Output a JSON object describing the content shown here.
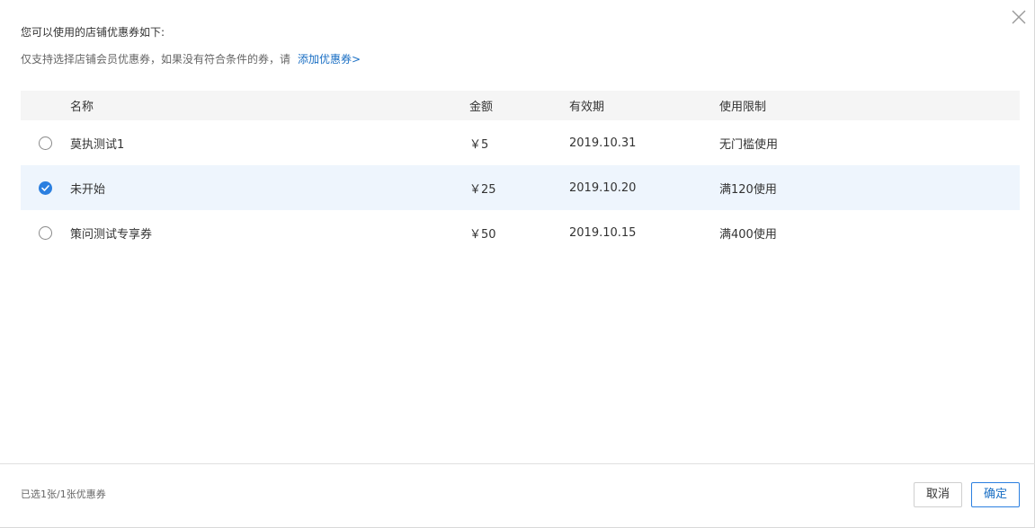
{
  "dialog": {
    "intro_title": "您可以使用的店铺优惠券如下:",
    "intro_hint": "仅支持选择店铺会员优惠券，如果没有符合条件的券，请",
    "add_link": "添加优惠券>",
    "close_icon": "close-icon"
  },
  "table": {
    "headers": {
      "name": "名称",
      "amount": "金额",
      "validity": "有效期",
      "limit": "使用限制"
    },
    "rows": [
      {
        "name": "莫执测试1",
        "amount": "￥5",
        "validity": "2019.10.31",
        "limit": "无门槛使用",
        "selected": false
      },
      {
        "name": "未开始",
        "amount": "￥25",
        "validity": "2019.10.20",
        "limit": "满120使用",
        "selected": true
      },
      {
        "name": "策问测试专享券",
        "amount": "￥50",
        "validity": "2019.10.15",
        "limit": "满400使用",
        "selected": false
      }
    ]
  },
  "footer": {
    "selected_count": "已选1张/1张优惠券",
    "cancel_label": "取消",
    "ok_label": "确定"
  },
  "colors": {
    "accent": "#2b7fe0",
    "link": "#1a6fc4",
    "selected_row_bg": "#eef5fd",
    "header_bg": "#f5f5f5"
  }
}
